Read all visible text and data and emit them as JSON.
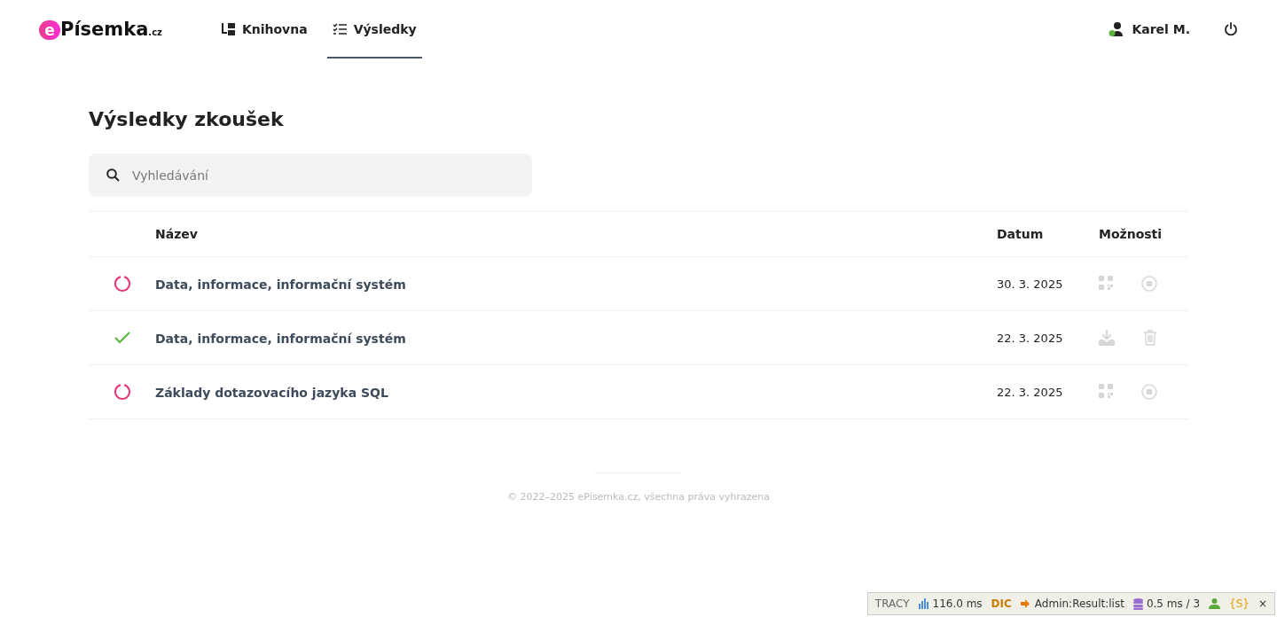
{
  "logo": {
    "mark": "e",
    "name": "Písemka",
    "suffix": ".cz"
  },
  "nav": [
    {
      "label": "Knihovna",
      "kind": "library",
      "selected": false
    },
    {
      "label": "Výsledky",
      "kind": "results",
      "selected": true
    }
  ],
  "user": {
    "name": "Karel M.",
    "online": true
  },
  "page_title": "Výsledky zkoušek",
  "search": {
    "placeholder": "Vyhledávání"
  },
  "table": {
    "columns": [
      "Název",
      "Datum",
      "Možnosti"
    ],
    "rows": [
      {
        "kind": "pending",
        "name": "Data, informace, informační systém",
        "date": "30. 3. 2025",
        "actions": [
          {
            "kind": "qr"
          },
          {
            "kind": "stop"
          }
        ]
      },
      {
        "kind": "done",
        "name": "Data, informace, informační systém",
        "date": "22. 3. 2025",
        "actions": [
          {
            "kind": "download"
          },
          {
            "kind": "trash"
          }
        ]
      },
      {
        "kind": "pending",
        "name": "Základy dotazovacího jazyka SQL",
        "date": "22. 3. 2025",
        "actions": [
          {
            "kind": "qr"
          },
          {
            "kind": "stop"
          }
        ]
      }
    ]
  },
  "footer": "© 2022–2025 ePísemka.cz, všechna práva vyhrazena",
  "debug_bar": {
    "brand": "TRACY",
    "time": "116.0 ms",
    "di": "DIC",
    "route": "Admin:Result:list",
    "db": "0.5 ms / 3",
    "session": "{S}",
    "close": "×"
  }
}
